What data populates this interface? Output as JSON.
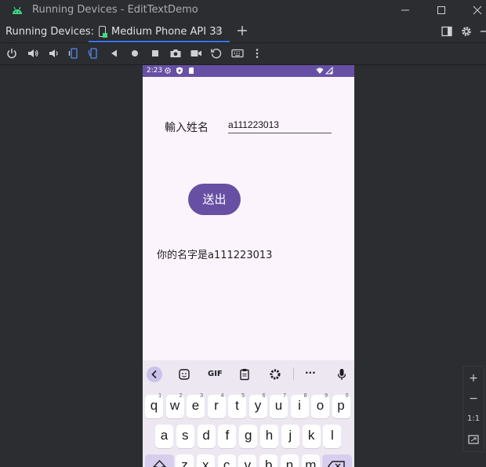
{
  "window": {
    "title": "Running Devices - EditTextDemo"
  },
  "tabbar": {
    "label": "Running Devices:",
    "tab_label": "Medium Phone API 33",
    "close": "×"
  },
  "status": {
    "time": "2:23"
  },
  "app": {
    "name_label": "輸入姓名",
    "name_value": "a111223013",
    "send_label": "送出",
    "result_text": "你的名字是a111223013"
  },
  "keyboard": {
    "gif": "GIF",
    "more": "···",
    "row1": [
      {
        "k": "q",
        "h": "1"
      },
      {
        "k": "w",
        "h": "2"
      },
      {
        "k": "e",
        "h": "3"
      },
      {
        "k": "r",
        "h": "4"
      },
      {
        "k": "t",
        "h": "5"
      },
      {
        "k": "y",
        "h": "6"
      },
      {
        "k": "u",
        "h": "7"
      },
      {
        "k": "i",
        "h": "8"
      },
      {
        "k": "o",
        "h": "9"
      },
      {
        "k": "p",
        "h": "0"
      }
    ],
    "row2": [
      "a",
      "s",
      "d",
      "f",
      "g",
      "h",
      "j",
      "k",
      "l"
    ],
    "row3": [
      "z",
      "x",
      "c",
      "v",
      "b",
      "n",
      "m"
    ]
  },
  "zoom_panel": {
    "plus": "+",
    "minus": "−",
    "one_to_one": "1:1"
  },
  "colors": {
    "accent": "#3574f0",
    "primary": "#6750a4",
    "android": "#3ddc84"
  },
  "icons": [
    "android-icon",
    "phone-icon",
    "power-icon",
    "volume-up-icon",
    "volume-down-icon",
    "rotate-left-icon",
    "rotate-right-icon",
    "back-icon",
    "home-icon",
    "overview-icon",
    "camera-icon",
    "record-icon",
    "reset-icon",
    "keyboard-icon",
    "more-icon"
  ]
}
